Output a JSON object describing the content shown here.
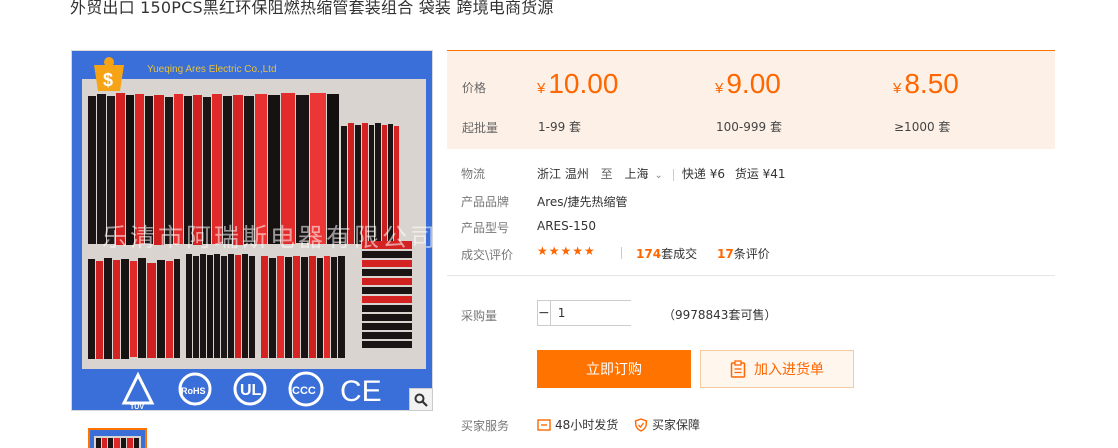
{
  "title": "外贸出口 150PCS黑红环保阻燃热缩管套装组合 袋装 跨境电商货源",
  "image": {
    "watermark_top": "Yueqing Ares Electric Co.,Ltd",
    "watermark_cn": "乐清市阿瑞斯电器有限公司",
    "cert_logos": [
      "TÜV",
      "RoHS",
      "UL",
      "CCC",
      "CE"
    ],
    "badge_icon": "dollar-badge-icon"
  },
  "price_box": {
    "price_label": "价格",
    "moq_label": "起批量",
    "currency": "¥",
    "tiers": [
      {
        "price": "10.00",
        "range": "1-99 套"
      },
      {
        "price": "9.00",
        "range": "100-999 套"
      },
      {
        "price": "8.50",
        "range": "≥1000 套"
      }
    ]
  },
  "logistics": {
    "label": "物流",
    "from": "浙江 温州",
    "to_word": "至",
    "to": "上海",
    "express": "快递 ¥6",
    "freight": "货运 ¥41"
  },
  "brand": {
    "label": "产品品牌",
    "value": "Ares/捷先热缩管"
  },
  "model": {
    "label": "产品型号",
    "value": "ARES-150"
  },
  "deals": {
    "label": "成交\\评价",
    "stars": "★★★★★",
    "rating": 5,
    "sold_count": "174",
    "sold_suffix": "套成交",
    "review_count": "17",
    "review_suffix": "条评价"
  },
  "purchase": {
    "label": "采购量",
    "quantity": "1",
    "stock": "（9978843套可售）",
    "buy_label": "立即订购",
    "cart_label": "加入进货单"
  },
  "services": {
    "label": "买家服务",
    "items": [
      "48小时发货",
      "买家保障"
    ]
  },
  "colors": {
    "accent": "#ff7300",
    "price": "#ff6600",
    "price_box_bg": "#fdf1e7",
    "image_bg": "#3c6fd6"
  }
}
